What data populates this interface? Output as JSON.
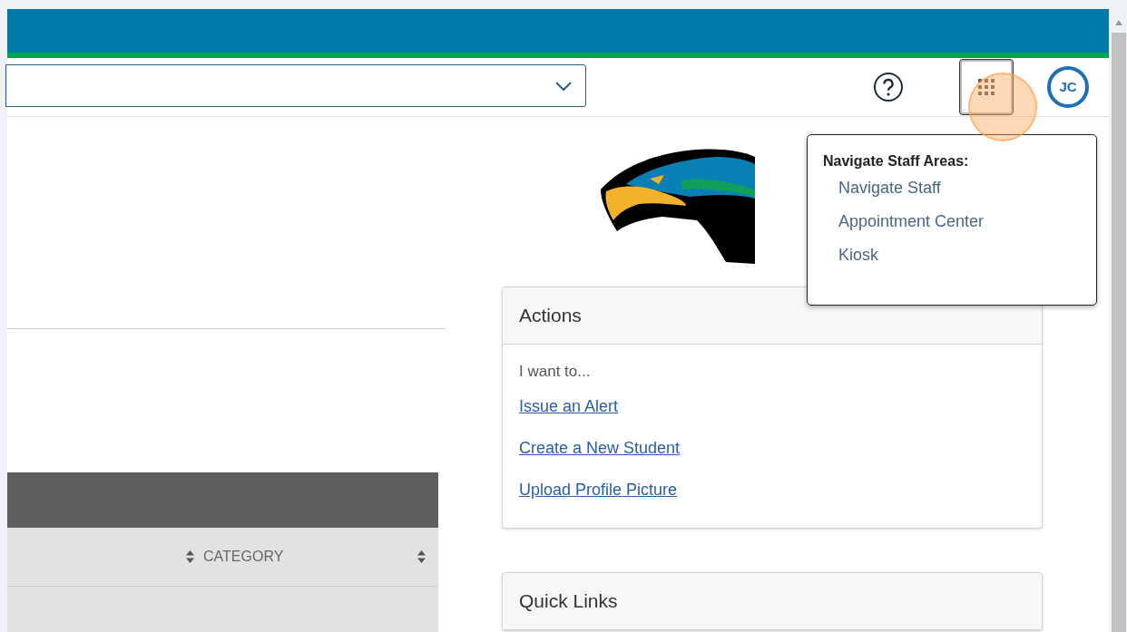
{
  "header": {
    "avatar_initials": "JC"
  },
  "staff_menu": {
    "title": "Navigate Staff Areas:",
    "items": [
      {
        "label": "Navigate Staff"
      },
      {
        "label": "Appointment Center"
      },
      {
        "label": "Kiosk"
      }
    ]
  },
  "table": {
    "columns": [
      "CATEGORY"
    ]
  },
  "actions": {
    "title": "Actions",
    "intro": "I want to...",
    "links": [
      "Issue an Alert",
      "Create a New Student",
      "Upload Profile Picture"
    ]
  },
  "quick_links": {
    "title": "Quick Links"
  }
}
